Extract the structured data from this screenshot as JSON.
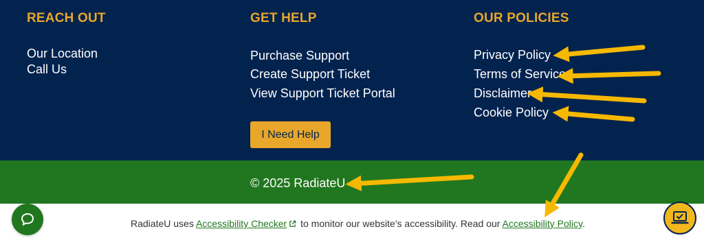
{
  "reach_out": {
    "heading": "REACH OUT",
    "links": [
      "Our Location",
      "Call Us"
    ]
  },
  "get_help": {
    "heading": "GET HELP",
    "links": [
      "Purchase Support",
      "Create Support Ticket",
      "View Support Ticket Portal"
    ],
    "button_label": "I Need Help"
  },
  "policies": {
    "heading": "OUR POLICIES",
    "links": [
      "Privacy Policy",
      "Terms of Service",
      "Disclaimer",
      "Cookie Policy"
    ]
  },
  "copyright": "© 2025 RadiateU",
  "accessibility_notice": {
    "prefix": "RadiateU uses ",
    "checker_link": "Accessibility Checker",
    "middle": " to monitor our website's accessibility. Read our ",
    "policy_link": "Accessibility Policy",
    "suffix": "."
  },
  "icons": {
    "chat": "chat-bubble-icon",
    "accessibility_badge": "laptop-check-icon",
    "external_link": "external-link-icon",
    "annotation_arrow": "arrow-icon"
  },
  "colors": {
    "navy": "#03234f",
    "gold": "#e8a72a",
    "green": "#21771f",
    "arrow_yellow": "#f6b800"
  }
}
